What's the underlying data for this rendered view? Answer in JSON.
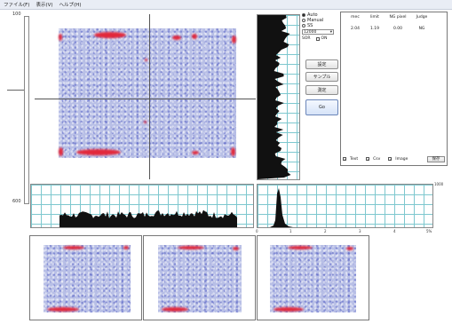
{
  "menu": [
    "ファイル(F)",
    "表示(V)",
    "ヘルプ(H)"
  ],
  "scale": {
    "top": "100",
    "bottom": "600"
  },
  "histogram": {
    "x_ticks": [
      "0",
      "1",
      "2",
      "3",
      "4",
      "5%"
    ],
    "y_max": "1000"
  },
  "mode": {
    "auto": "Auto",
    "manual": "Manual",
    "third": "SS",
    "selected": "auto",
    "combo_value": "12000",
    "combo_prefix": "SOR",
    "check_label": "ON"
  },
  "buttons": {
    "settings": "設定",
    "sample": "サンプル",
    "measure": "測定",
    "go": "Go"
  },
  "results": {
    "columns": [
      "mec",
      "limit",
      "NG pixel",
      "Judge"
    ],
    "rows": [
      [
        "2.04",
        "1.19",
        "0.00",
        "NG"
      ]
    ],
    "footer": {
      "text": "Text",
      "csv": "Csv",
      "image": "Image",
      "save": "保存"
    }
  },
  "colors": {
    "heat": "#e2283b",
    "field": "#b8bfe6",
    "grid": "#7ec8cf",
    "profile": "#111111"
  }
}
